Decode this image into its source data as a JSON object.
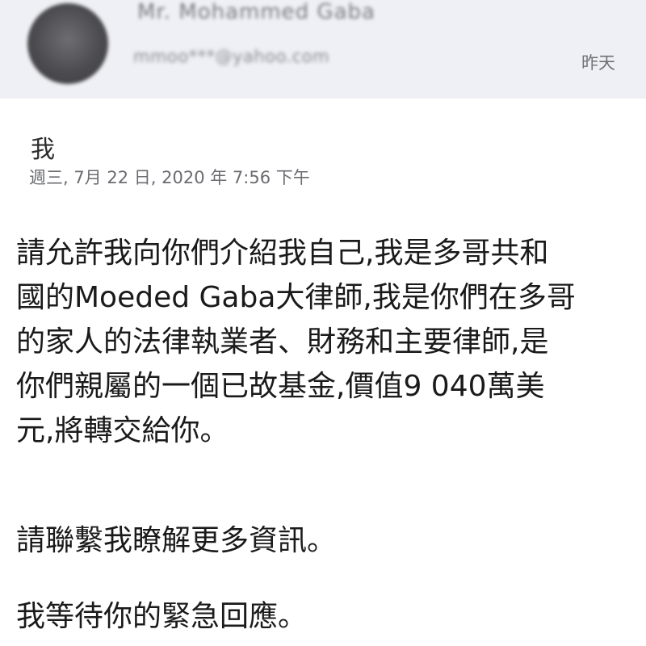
{
  "header": {
    "sender_name": "Mr. Mohammed Gaba",
    "sender_email": "mmoo***@yahoo.com",
    "date_label": "昨天"
  },
  "message": {
    "recipient": "我",
    "timestamp": "週三, 7月 22 日, 2020 年 7:56 下午",
    "paragraphs": [
      "請允許我向你們介紹我自己,我是多哥共和\n國的Moeded Gaba大律師,我是你們在多哥\n的家人的法律執業者、財務和主要律師,是\n你們親屬的一個已故基金,價值9 040萬美\n元,將轉交給你。",
      "請聯繫我瞭解更多資訊。",
      "我等待你的緊急回應。"
    ]
  }
}
